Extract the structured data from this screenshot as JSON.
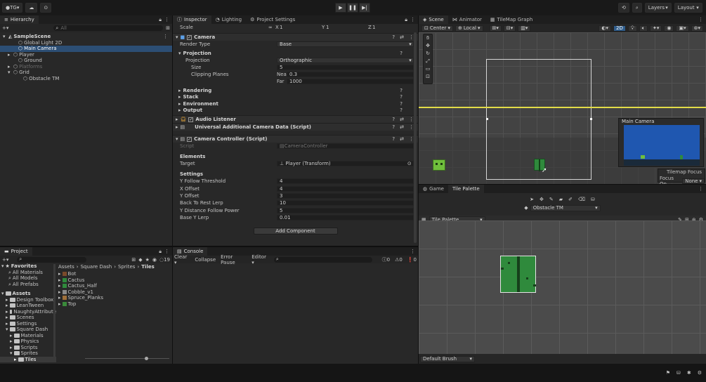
{
  "topbar": {
    "account": "TG",
    "layers_label": "Layers",
    "layout_label": "Layout"
  },
  "hierarchy": {
    "tab": "Hierarchy",
    "search_placeholder": "All",
    "items": [
      {
        "label": "SampleScene",
        "indent": 0,
        "kind": "scene"
      },
      {
        "label": "Global Light 2D",
        "indent": 2,
        "kind": "obj"
      },
      {
        "label": "Main Camera",
        "indent": 2,
        "kind": "obj",
        "selected": true
      },
      {
        "label": "Player",
        "indent": 1,
        "kind": "obj"
      },
      {
        "label": "Ground",
        "indent": 2,
        "kind": "obj"
      },
      {
        "label": "Platforms",
        "indent": 1,
        "kind": "obj",
        "dim": true
      },
      {
        "label": "Grid",
        "indent": 1,
        "kind": "obj"
      },
      {
        "label": "Obstacle TM",
        "indent": 3,
        "kind": "obj"
      }
    ]
  },
  "inspector": {
    "tabs": [
      "Inspector",
      "Lighting",
      "Project Settings"
    ],
    "scale_label": "Scale",
    "scale_x_label": "X",
    "scale_x": "1",
    "scale_y_label": "Y",
    "scale_y": "1",
    "scale_z_label": "Z",
    "scale_z": "1",
    "camera": {
      "title": "Camera",
      "render_type_label": "Render Type",
      "render_type": "Base",
      "projection_header": "Projection",
      "projection_label": "Projection",
      "projection": "Orthographic",
      "size_label": "Size",
      "size": "5",
      "clipping_label": "Clipping Planes",
      "near_label": "Near",
      "near": "0.3",
      "far_label": "Far",
      "far": "1000"
    },
    "collapsed": [
      "Rendering",
      "Stack",
      "Environment",
      "Output"
    ],
    "audio_listener": "Audio Listener",
    "uacd": "Universal Additional Camera Data (Script)",
    "controller": {
      "title": "Camera Controller (Script)",
      "script_label": "Script",
      "script": "CameraController",
      "elements_header": "Elements",
      "target_label": "Target",
      "target": "Player (Transform)",
      "settings_header": "Settings",
      "fields": [
        {
          "label": "Y Follow Threshold",
          "value": "4"
        },
        {
          "label": "X Offset",
          "value": "4"
        },
        {
          "label": "Y Offset",
          "value": "3"
        },
        {
          "label": "Back To Rest Lerp",
          "value": "10"
        },
        {
          "label": "Y Distance Follow Power",
          "value": "5"
        },
        {
          "label": "Base Y Lerp",
          "value": "0.01"
        }
      ]
    },
    "add_component": "Add Component"
  },
  "project": {
    "tab": "Project",
    "count": "19",
    "favorites": {
      "label": "Favorites",
      "items": [
        "All Materials",
        "All Models",
        "All Prefabs"
      ]
    },
    "assets": {
      "label": "Assets",
      "items": [
        {
          "label": "Design Toolbox",
          "indent": 1
        },
        {
          "label": "LeanTween",
          "indent": 1
        },
        {
          "label": "NaughtyAttribute",
          "indent": 1
        },
        {
          "label": "Scenes",
          "indent": 1
        },
        {
          "label": "Settings",
          "indent": 1
        },
        {
          "label": "Square Dash",
          "indent": 1
        },
        {
          "label": "Materials",
          "indent": 2
        },
        {
          "label": "Physics",
          "indent": 2
        },
        {
          "label": "Scripts",
          "indent": 2
        },
        {
          "label": "Sprites",
          "indent": 2
        },
        {
          "label": "Tiles",
          "indent": 3
        }
      ]
    },
    "breadcrumb": [
      "Assets",
      "Square Dash",
      "Sprites",
      "Tiles"
    ],
    "files": [
      "Bot",
      "Cactus",
      "Cactus_Half",
      "Cobble_v1",
      "Spruce_Planks",
      "Top"
    ]
  },
  "console": {
    "tab": "Console",
    "clear": "Clear",
    "collapse": "Collapse",
    "error_pause": "Error Pause",
    "editor": "Editor",
    "counts": [
      "0",
      "0",
      "0"
    ]
  },
  "scene": {
    "tabs": [
      "Scene",
      "Animator",
      "TileMap Graph"
    ],
    "center": "Center",
    "local": "Local",
    "mode_2d": "2D",
    "overlay_title": "Main Camera",
    "tilemap_focus": "Tilemap Focus",
    "focus_on_label": "Focus On",
    "focus_on": "None"
  },
  "palette": {
    "tabs": [
      "Game",
      "Tile Palette"
    ],
    "target": "Obstacle TM",
    "palette_name": "Tile Palette",
    "brush": "Default Brush"
  },
  "colors": {
    "accent": "#2c4e74",
    "tile_green": "#3fa84a",
    "camera_bg": "#1f57b0",
    "camera_yellow_line": "#e2dc48"
  }
}
